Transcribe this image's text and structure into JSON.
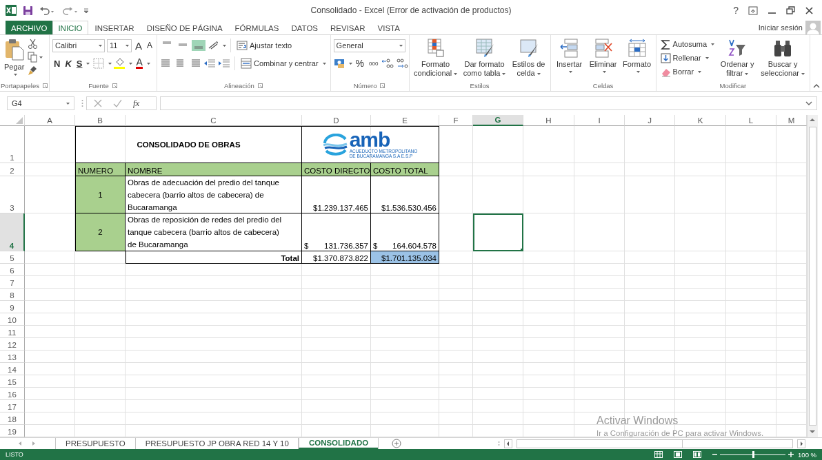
{
  "window": {
    "title": "Consolidado - Excel (Error de activación de productos)",
    "help": "?"
  },
  "ribbon_tabs": [
    {
      "label": "ARCHIVO",
      "kind": "file",
      "selected": false
    },
    {
      "label": "INICIO",
      "kind": "tab",
      "selected": true
    },
    {
      "label": "INSERTAR",
      "kind": "tab",
      "selected": false
    },
    {
      "label": "DISEÑO DE PÁGINA",
      "kind": "tab",
      "selected": false
    },
    {
      "label": "FÓRMULAS",
      "kind": "tab",
      "selected": false
    },
    {
      "label": "DATOS",
      "kind": "tab",
      "selected": false
    },
    {
      "label": "REVISAR",
      "kind": "tab",
      "selected": false
    },
    {
      "label": "VISTA",
      "kind": "tab",
      "selected": false
    }
  ],
  "account": {
    "label": "Iniciar sesión"
  },
  "ribbon": {
    "clipboard": {
      "label": "Portapapeles",
      "paste": "Pegar"
    },
    "font": {
      "label": "Fuente",
      "name": "Calibri",
      "size": "11",
      "grow": "A",
      "shrink": "A",
      "bold": "N",
      "italic": "K",
      "underline": "S",
      "font_color_label": "A"
    },
    "alignment": {
      "label": "Alineación",
      "vertical": [
        {
          "selected": false
        },
        {
          "selected": false
        },
        {
          "selected": true
        }
      ],
      "wrap": "Ajustar texto",
      "merge": "Combinar y centrar"
    },
    "number": {
      "label": "Número",
      "format": "General",
      "percent": "%",
      "thousands": "000"
    },
    "styles": {
      "label": "Estilos",
      "buttons": [
        "Formato condicional",
        "Dar formato como tabla",
        "Estilos de celda"
      ]
    },
    "cells": {
      "label": "Celdas",
      "buttons": [
        "Insertar",
        "Eliminar",
        "Formato"
      ]
    },
    "editing": {
      "label": "Modificar",
      "commands": [
        "Autosuma",
        "Rellenar",
        "Borrar"
      ],
      "buttons": [
        "Ordenar y filtrar",
        "Buscar y seleccionar"
      ]
    }
  },
  "formula_bar": {
    "name_box": "G4",
    "function_label": "fx"
  },
  "sheet": {
    "columns": [
      {
        "label": "A",
        "selected": false
      },
      {
        "label": "B",
        "selected": false
      },
      {
        "label": "C",
        "selected": false
      },
      {
        "label": "D",
        "selected": false
      },
      {
        "label": "E",
        "selected": false
      },
      {
        "label": "F",
        "selected": false
      },
      {
        "label": "G",
        "selected": true
      },
      {
        "label": "H",
        "selected": false
      },
      {
        "label": "I",
        "selected": false
      },
      {
        "label": "J",
        "selected": false
      },
      {
        "label": "K",
        "selected": false
      },
      {
        "label": "L",
        "selected": false
      },
      {
        "label": "M",
        "selected": false
      }
    ],
    "rows": [
      {
        "label": "1",
        "selected": false
      },
      {
        "label": "2",
        "selected": false
      },
      {
        "label": "3",
        "selected": false
      },
      {
        "label": "4",
        "selected": true
      },
      {
        "label": "5",
        "selected": false
      },
      {
        "label": "6",
        "selected": false
      },
      {
        "label": "7",
        "selected": false
      },
      {
        "label": "8",
        "selected": false
      },
      {
        "label": "9",
        "selected": false
      },
      {
        "label": "10",
        "selected": false
      },
      {
        "label": "11",
        "selected": false
      },
      {
        "label": "12",
        "selected": false
      },
      {
        "label": "13",
        "selected": false
      },
      {
        "label": "14",
        "selected": false
      },
      {
        "label": "15",
        "selected": false
      },
      {
        "label": "16",
        "selected": false
      },
      {
        "label": "17",
        "selected": false
      },
      {
        "label": "18",
        "selected": false
      },
      {
        "label": "19",
        "selected": false
      }
    ],
    "table": {
      "title": "CONSOLIDADO DE OBRAS",
      "logo": {
        "wordmark": "amb",
        "tagline": [
          "ACUEDUCTO METROPOLITANO",
          "DE BUCARAMANGA S.A E.S.P"
        ]
      },
      "headers": [
        "NUMERO",
        "NOMBRE",
        "COSTO DIRECTO",
        "COSTO TOTAL"
      ],
      "rows": [
        {
          "number": "1",
          "name": "Obras de adecuación del predio del tanque cabecera (barrio altos de cabecera) de Bucaramanga",
          "costs": [
            {
              "kind": "plain",
              "text": "$1.239.137.465"
            },
            {
              "kind": "plain",
              "text": "$1.536.530.456"
            }
          ]
        },
        {
          "number": "2",
          "name": "Obras de reposición de redes del predio del tanque cabecera (barrio altos de cabecera) de Bucaramanga",
          "costs": [
            {
              "kind": "accounting",
              "symbol": "$",
              "amount": "131.736.357"
            },
            {
              "kind": "accounting",
              "symbol": "$",
              "amount": "164.604.578"
            }
          ]
        }
      ],
      "total": {
        "label": "Total",
        "values": [
          {
            "text": "$1.370.873.822",
            "highlighted": false
          },
          {
            "text": "$1.701.135.034",
            "highlighted": true
          }
        ]
      }
    }
  },
  "sheet_tabs": [
    {
      "label": "PRESUPUESTO",
      "selected": false
    },
    {
      "label": "PRESUPUESTO JP OBRA RED 14 Y 10",
      "selected": false
    },
    {
      "label": "CONSOLIDADO",
      "selected": true
    }
  ],
  "status_bar": {
    "status": "LISTO",
    "zoom": {
      "label": "100 %",
      "level": 0.5
    }
  },
  "activation_notice": {
    "title": "Activar Windows",
    "message": "Ir a Configuración de PC para activar Windows."
  }
}
